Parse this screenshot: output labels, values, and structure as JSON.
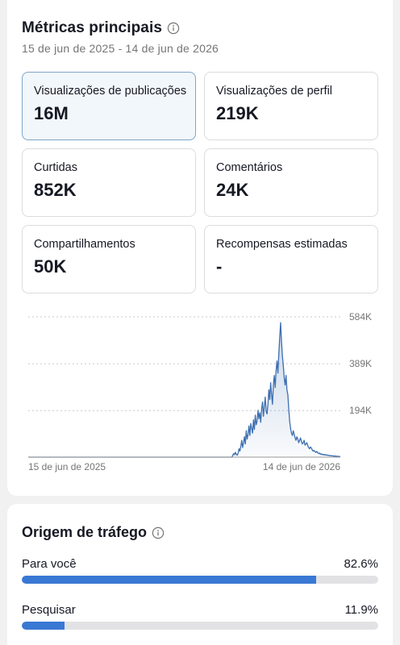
{
  "metrics": {
    "title": "Métricas principais",
    "date_range": "15 de jun de 2025 - 14 de jun de 2026",
    "tiles": [
      {
        "label": "Visualizações de publicações",
        "value": "16M",
        "selected": true
      },
      {
        "label": "Visualizações de perfil",
        "value": "219K",
        "selected": false
      },
      {
        "label": "Curtidas",
        "value": "852K",
        "selected": false
      },
      {
        "label": "Comentários",
        "value": "24K",
        "selected": false
      },
      {
        "label": "Compartilhamentos",
        "value": "50K",
        "selected": false
      },
      {
        "label": "Recompensas estimadas",
        "value": "-",
        "selected": false
      }
    ]
  },
  "chart_data": {
    "type": "area",
    "x_start_label": "15 de jun de 2025",
    "x_end_label": "14 de jun de 2026",
    "y_ticks": [
      {
        "value": 194000,
        "label": "194K"
      },
      {
        "value": 389000,
        "label": "389K"
      },
      {
        "value": 584000,
        "label": "584K"
      }
    ],
    "ylim": [
      0,
      584000
    ],
    "grid": true,
    "color": "#3d6fb0",
    "values": [
      0,
      0,
      0,
      0,
      0,
      0,
      0,
      0,
      0,
      0,
      0,
      0,
      0,
      0,
      0,
      0,
      0,
      0,
      0,
      0,
      0,
      0,
      0,
      0,
      0,
      0,
      0,
      0,
      0,
      0,
      0,
      0,
      0,
      0,
      0,
      0,
      0,
      0,
      0,
      0,
      0,
      0,
      0,
      0,
      0,
      0,
      0,
      0,
      0,
      0,
      0,
      0,
      0,
      0,
      0,
      0,
      0,
      0,
      0,
      0,
      0,
      0,
      0,
      0,
      0,
      0,
      0,
      0,
      0,
      0,
      0,
      0,
      0,
      0,
      0,
      0,
      0,
      0,
      0,
      0,
      0,
      0,
      0,
      0,
      0,
      0,
      0,
      0,
      0,
      0,
      0,
      0,
      0,
      0,
      0,
      0,
      0,
      0,
      0,
      0,
      0,
      0,
      0,
      0,
      0,
      0,
      0,
      0,
      0,
      0,
      0,
      0,
      0,
      0,
      0,
      0,
      0,
      0,
      0,
      0,
      0,
      0,
      0,
      0,
      0,
      0,
      0,
      0,
      0,
      0,
      0,
      0,
      0,
      0,
      0,
      0,
      0,
      0,
      0,
      0,
      0,
      0,
      0,
      0,
      0,
      0,
      0,
      0,
      0,
      0,
      0,
      0,
      0,
      0,
      0,
      0,
      0,
      0,
      0,
      0,
      0,
      0,
      0,
      0,
      0,
      0,
      0,
      0,
      0,
      0,
      0,
      0,
      0,
      0,
      0,
      0,
      0,
      0,
      0,
      0,
      0,
      0,
      0,
      0,
      0,
      0,
      0,
      0,
      0,
      0,
      0,
      0,
      0,
      0,
      0,
      0,
      0,
      0,
      0,
      0,
      0,
      0,
      0,
      0,
      0,
      0,
      0,
      0,
      0,
      0,
      0,
      0,
      0,
      0,
      0,
      0,
      0,
      0,
      0,
      0,
      0,
      0,
      0,
      0,
      0,
      0,
      6000,
      15000,
      10000,
      20000,
      12000,
      8000,
      16000,
      35000,
      25000,
      45000,
      70000,
      40000,
      60000,
      85000,
      55000,
      110000,
      75000,
      95000,
      130000,
      90000,
      140000,
      120000,
      100000,
      155000,
      115000,
      175000,
      135000,
      150000,
      195000,
      160000,
      185000,
      145000,
      200000,
      230000,
      170000,
      210000,
      250000,
      190000,
      180000,
      220000,
      280000,
      240000,
      310000,
      260000,
      220000,
      300000,
      340000,
      290000,
      360000,
      400000,
      350000,
      430000,
      500000,
      560000,
      480000,
      420000,
      380000,
      330000,
      300000,
      340000,
      280000,
      260000,
      200000,
      150000,
      120000,
      100000,
      90000,
      110000,
      95000,
      80000,
      70000,
      85000,
      75000,
      60000,
      70000,
      80000,
      65000,
      55000,
      60000,
      70000,
      50000,
      55000,
      60000,
      48000,
      40000,
      35000,
      42000,
      38000,
      30000,
      25000,
      28000,
      22000,
      20000,
      24000,
      18000,
      15000,
      17000,
      12000,
      14000,
      10000,
      12000,
      9000,
      11000,
      8000,
      10000,
      7000,
      8000,
      6000,
      7000,
      5000,
      6000,
      5000,
      4000,
      5000,
      4000,
      3000,
      4000,
      3000,
      2000,
      3000
    ]
  },
  "traffic": {
    "title": "Origem de tráfego",
    "sources": [
      {
        "label": "Para você",
        "pct_text": "82.6%",
        "pct": 82.6
      },
      {
        "label": "Pesquisar",
        "pct_text": "11.9%",
        "pct": 11.9
      }
    ]
  }
}
